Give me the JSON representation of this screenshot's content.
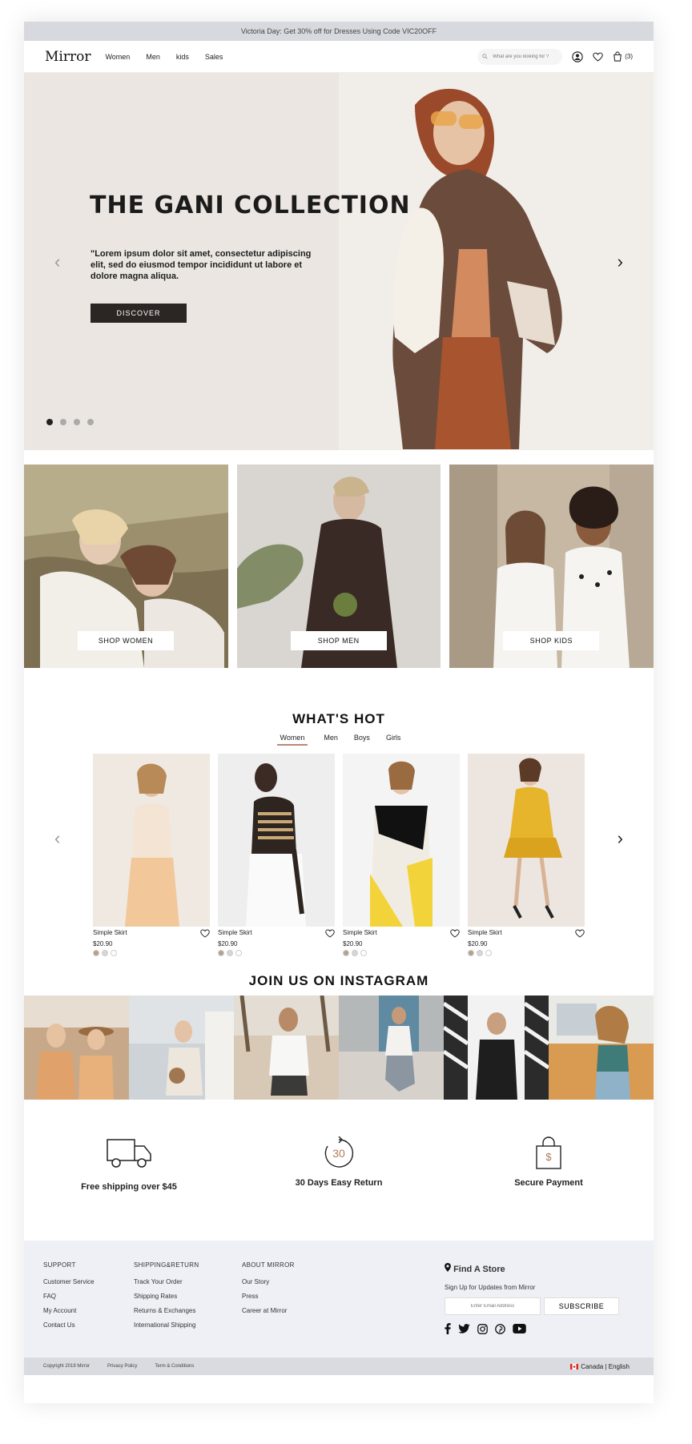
{
  "promo": {
    "text": "Victoria Day: Get 30% off for Dresses Using Code VIC20OFF"
  },
  "header": {
    "logo": "Mirror",
    "nav": [
      "Women",
      "Men",
      "kids",
      "Sales"
    ],
    "search_placeholder": "What are you looking for ?",
    "cart_count": "(3)"
  },
  "hero": {
    "title": "THE GANI COLLECTION",
    "text": "\"Lorem ipsum dolor sit amet, consectetur adipiscing elit, sed do eiusmod tempor incididunt ut labore et dolore magna aliqua.",
    "button": "DISCOVER",
    "slide_count": 4,
    "active_slide": 1
  },
  "categories": [
    {
      "label": "SHOP WOMEN"
    },
    {
      "label": "SHOP MEN"
    },
    {
      "label": "SHOP KIDS"
    }
  ],
  "whats_hot": {
    "title": "WHAT'S HOT",
    "tabs": [
      "Women",
      "Men",
      "Boys",
      "Girls"
    ],
    "active_tab": "Women",
    "products": [
      {
        "name": "Simple Skirt",
        "price": "$20.90"
      },
      {
        "name": "Simple Skirt",
        "price": "$20.90"
      },
      {
        "name": "Simple Skirt",
        "price": "$20.90"
      },
      {
        "name": "Simple Skirt",
        "price": "$20.90"
      }
    ],
    "swatch_colors": [
      "#b9a08a",
      "#d6d6d6",
      "#ffffff"
    ]
  },
  "instagram": {
    "title": "JOIN US ON INSTAGRAM"
  },
  "features": [
    {
      "icon": "truck-icon",
      "label": "Free shipping over $45"
    },
    {
      "icon": "return-30-icon",
      "label": "30 Days Easy Return",
      "icon_text": "30"
    },
    {
      "icon": "shopping-bag-dollar-icon",
      "label": "Secure Payment",
      "icon_text": "$"
    }
  ],
  "footer": {
    "columns": [
      {
        "title": "SUPPORT",
        "links": [
          "Customer Service",
          "FAQ",
          "My Account",
          "Contact Us"
        ]
      },
      {
        "title": "SHIPPING&RETURN",
        "links": [
          "Track Your Order",
          "Shipping Rates",
          "Returns & Exchanges",
          "International Shipping"
        ]
      },
      {
        "title": "ABOUT MIRROR",
        "links": [
          "Our Story",
          "Press",
          "Career at Mirror"
        ]
      }
    ],
    "store_title": "Find A Store",
    "signup_text": "Sign Up for Updates from Mirror",
    "email_placeholder": "Enter Email Address",
    "subscribe": "SUBSCRIBE",
    "social": [
      "facebook-icon",
      "twitter-icon",
      "instagram-icon",
      "pinterest-icon",
      "youtube-icon"
    ]
  },
  "bottom": {
    "copyright": "Copyright 2019 Mirror",
    "privacy": "Privacy Policy",
    "terms": "Term & Conditions",
    "language": "Canada | English"
  }
}
